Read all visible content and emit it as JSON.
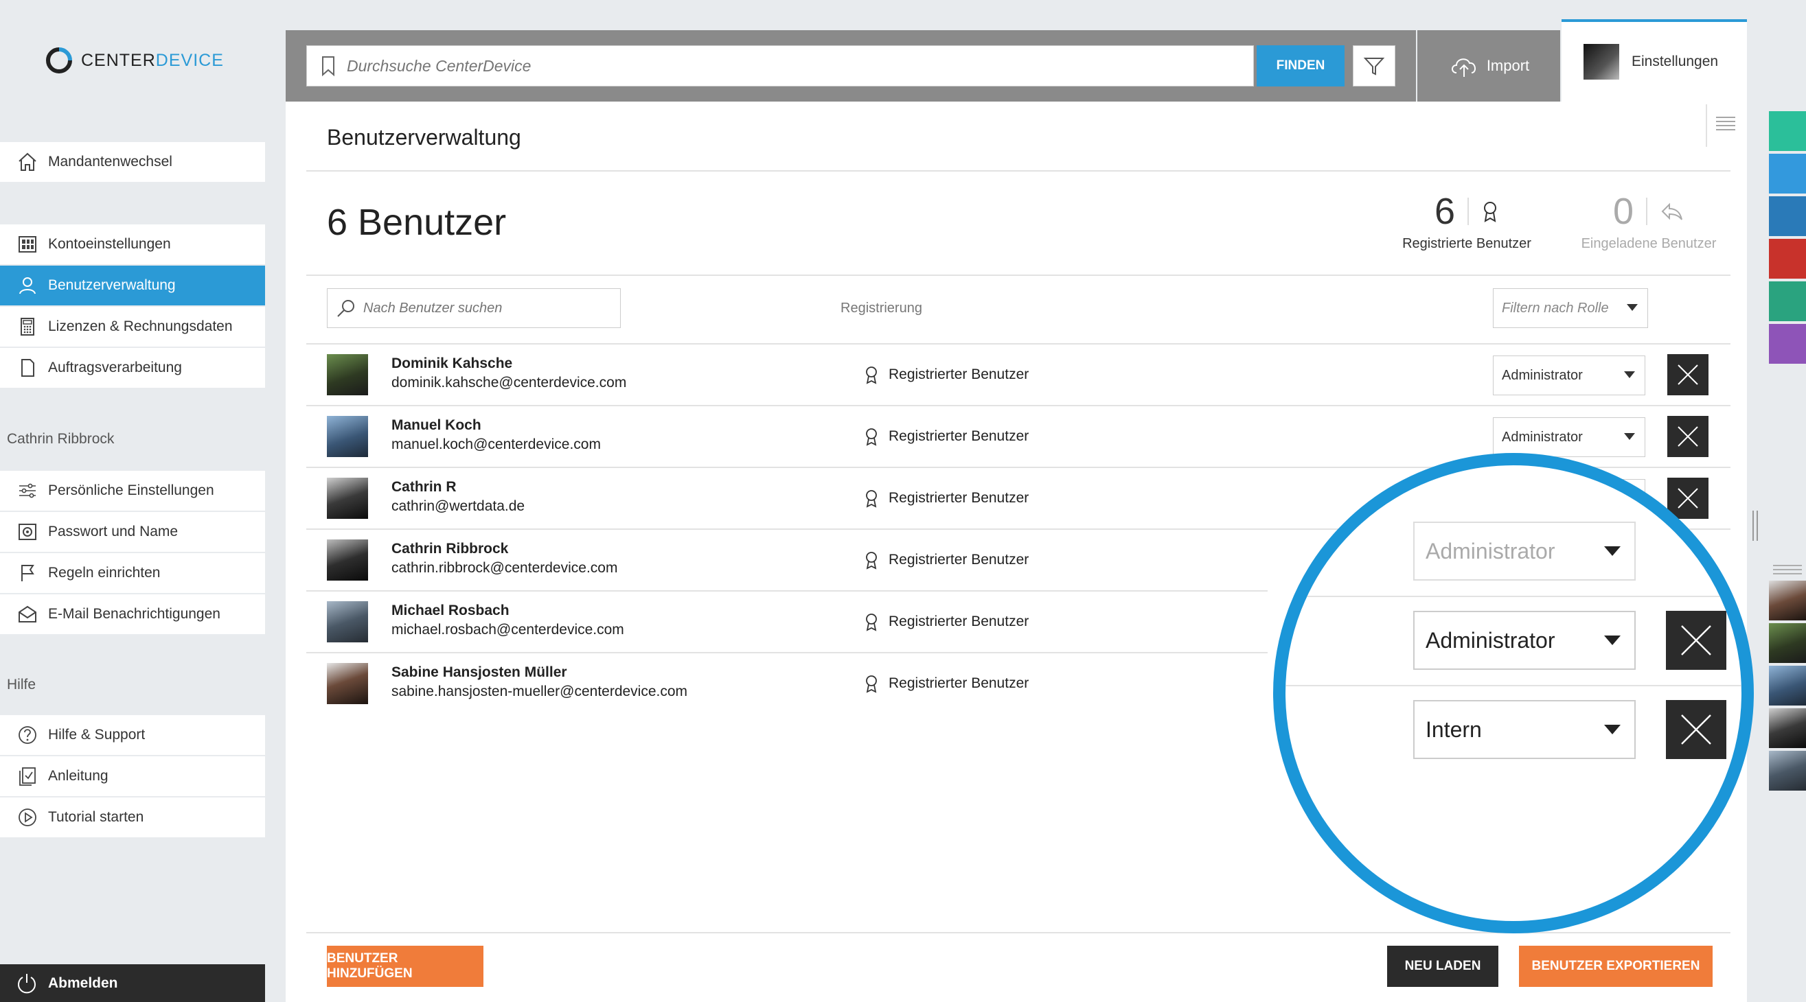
{
  "brand": {
    "logo_left": "CENTER",
    "logo_right": "DEVICE",
    "accent": "#2b9ad6"
  },
  "sidebar": {
    "top_item": {
      "label": "Mandantenwechsel",
      "icon": "home-icon"
    },
    "account_items": [
      {
        "label": "Kontoeinstellungen",
        "icon": "grid-icon"
      },
      {
        "label": "Benutzerverwaltung",
        "icon": "user-icon",
        "active": true
      },
      {
        "label": "Lizenzen & Rechnungsdaten",
        "icon": "calculator-icon"
      },
      {
        "label": "Auftragsverarbeitung",
        "icon": "document-icon"
      }
    ],
    "user_section": "Cathrin Ribbrock",
    "user_items": [
      {
        "label": "Persönliche Einstellungen",
        "icon": "sliders-icon"
      },
      {
        "label": "Passwort und Name",
        "icon": "safe-icon"
      },
      {
        "label": "Regeln einrichten",
        "icon": "flag-icon"
      },
      {
        "label": "E-Mail Benachrichtigungen",
        "icon": "mail-icon"
      }
    ],
    "help_section": "Hilfe",
    "help_items": [
      {
        "label": "Hilfe & Support",
        "icon": "question-icon"
      },
      {
        "label": "Anleitung",
        "icon": "checklist-icon"
      },
      {
        "label": "Tutorial starten",
        "icon": "play-icon"
      }
    ],
    "logout": "Abmelden"
  },
  "topbar": {
    "search_placeholder": "Durchsuche CenterDevice",
    "find_label": "FINDEN",
    "import_label": "Import",
    "settings_label": "Einstellungen"
  },
  "main": {
    "title": "Benutzerverwaltung",
    "user_count_label": "6 Benutzer",
    "stats": [
      {
        "value": "6",
        "label": "Registrierte Benutzer"
      },
      {
        "value": "0",
        "label": "Eingeladene Benutzer"
      }
    ],
    "user_search_placeholder": "Nach Benutzer suchen",
    "column_registration": "Registrierung",
    "role_filter_placeholder": "Filtern nach Rolle",
    "users": [
      {
        "name": "Dominik Kahsche",
        "email": "dominik.kahsche@centerdevice.com",
        "status": "Registrierter Benutzer",
        "role": "Administrator"
      },
      {
        "name": "Manuel Koch",
        "email": "manuel.koch@centerdevice.com",
        "status": "Registrierter Benutzer",
        "role": "Administrator"
      },
      {
        "name": "Cathrin R",
        "email": "cathrin@wertdata.de",
        "status": "Registrierter Benutzer",
        "role": ""
      },
      {
        "name": "Cathrin Ribbrock",
        "email": "cathrin.ribbrock@centerdevice.com",
        "status": "Registrierter Benutzer",
        "role": ""
      },
      {
        "name": "Michael Rosbach",
        "email": "michael.rosbach@centerdevice.com",
        "status": "Registrierter Benutzer",
        "role": ""
      },
      {
        "name": "Sabine Hansjosten Müller",
        "email": "sabine.hansjosten-mueller@centerdevice.com",
        "status": "Registrierter Benutzer",
        "role": ""
      }
    ],
    "buttons": {
      "add_users": "BENUTZER HINZUFÜGEN",
      "reload": "NEU LADEN",
      "export": "BENUTZER EXPORTIEREN"
    }
  },
  "zoom": {
    "roles": [
      "Administrator",
      "Administrator",
      "Intern"
    ]
  },
  "colors": {
    "orange": "#f07c3a",
    "dark": "#2b2b2b",
    "swatches": [
      "#2bbf9a",
      "#3399dd",
      "#2a7ab8",
      "#c8322b",
      "#2aa37f",
      "#8e54b8"
    ]
  }
}
